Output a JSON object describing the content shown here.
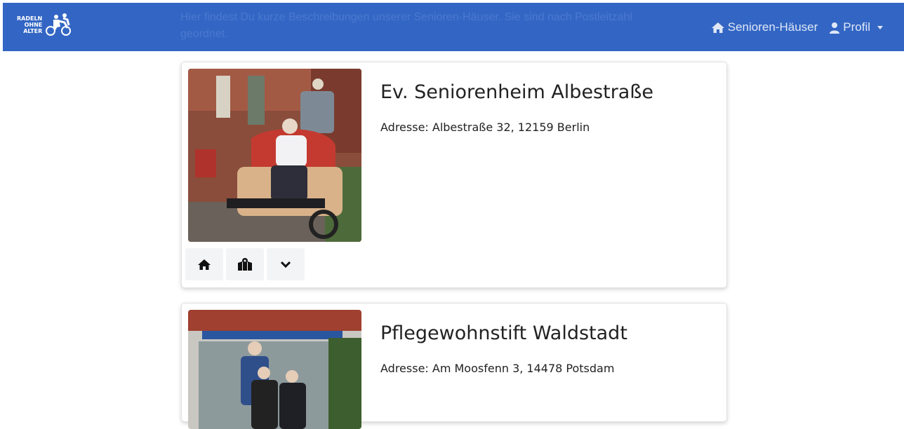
{
  "navbar": {
    "logo_lines": [
      "RADELN",
      "OHNE",
      "ALTER"
    ],
    "description": "Hier findest Du kurze Beschreibungen unserer Senioren-Häuser. Sie sind nach Postleitzahl geordnet.",
    "links": [
      {
        "label": "Senioren-Häuser",
        "icon": "home-icon"
      },
      {
        "label": "Profil",
        "icon": "user-icon"
      }
    ]
  },
  "homes": [
    {
      "name": "Ev. Seniorenheim Albestraße",
      "address": "Adresse: Albestraße 32, 12159 Berlin"
    },
    {
      "name": "Pflegewohnstift Waldstadt",
      "address": "Adresse: Am Moosfenn 3, 14478 Potsdam"
    }
  ],
  "card_actions": [
    {
      "icon": "home-icon"
    },
    {
      "icon": "map-icon"
    },
    {
      "icon": "chevron-down-icon"
    }
  ],
  "colors": {
    "navbar": "#3366c4",
    "card_button": "#f3f4f5"
  }
}
